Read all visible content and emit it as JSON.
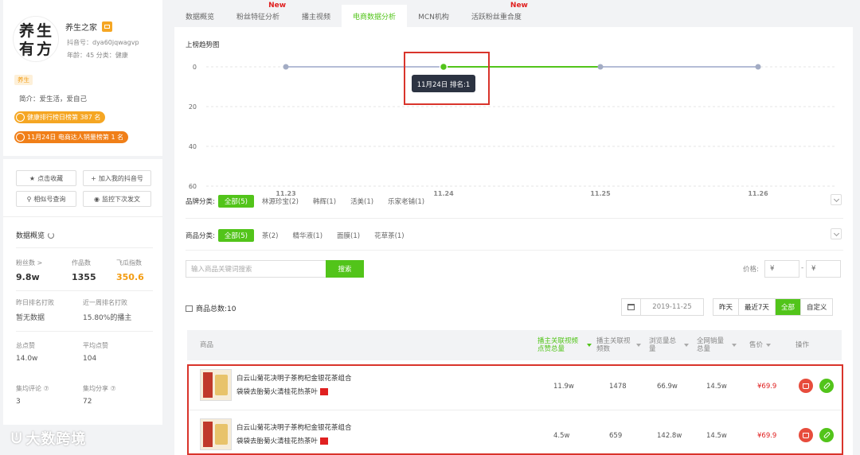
{
  "profile": {
    "avatar_text": "养生有方",
    "name": "养生之家",
    "douyin_id": "抖音号：dya60jqwagvp",
    "age_category": "年龄：45    分类：健康",
    "tag": "养生",
    "intro": "简介：爱生活，爱自己",
    "rank1": "健康排行榜日榜第 387 名",
    "rank2": "11月24日 电商达人销量榜第 1 名"
  },
  "actions": {
    "favorite": "点击收藏",
    "add_my": "加入我的抖音号",
    "similar": "相似号查询",
    "monitor": "监控下次发文"
  },
  "stats": {
    "title": "数据概览",
    "fans_label": "粉丝数 >",
    "fans_value": "9.8w",
    "works_label": "作品数",
    "works_value": "1355",
    "index_label": "飞瓜指数",
    "index_value": "350.6",
    "yesterday_rank_label": "昨日排名打败",
    "yesterday_rank_value": "暂无数据",
    "week_rank_label": "近一周排名打败",
    "week_rank_value": "15.80%的播主",
    "total_likes_label": "总点赞",
    "total_likes_value": "14.0w",
    "avg_likes_label": "平均点赞",
    "avg_likes_value": "104",
    "avg_comments_label": "集均评论 ⑦",
    "avg_comments_value": "3",
    "avg_shares_label": "集均分享 ⑦",
    "avg_shares_value": "72"
  },
  "watermark": "大数跨境",
  "tabs": [
    {
      "label": "数据概览",
      "new": ""
    },
    {
      "label": "粉丝特征分析",
      "new": "New"
    },
    {
      "label": "播主视频",
      "new": ""
    },
    {
      "label": "电商数据分析",
      "new": ""
    },
    {
      "label": "MCN机构",
      "new": ""
    },
    {
      "label": "活跃粉丝重合度",
      "new": "New"
    }
  ],
  "chart_data": {
    "type": "line",
    "title": "上榜趋势图",
    "categories": [
      "11.23",
      "11.24",
      "11.25",
      "11.26"
    ],
    "values": [
      null,
      1,
      null,
      null
    ],
    "y_ticks": [
      "0",
      "20",
      "40",
      "60"
    ],
    "ylim": [
      0,
      60
    ],
    "y_inverted": true,
    "tooltip": "11月24日 排名:1",
    "line_color": "#52c41a",
    "base_color": "#b4bcd6"
  },
  "filters": {
    "brand_label": "品牌分类:",
    "brand_options": [
      "全部(5)",
      "林源珍宝(2)",
      "韩辉(1)",
      "活美(1)",
      "乐家老铺(1)"
    ],
    "category_label": "商品分类:",
    "category_options": [
      "全部(5)",
      "茶(2)",
      "精华液(1)",
      "面膜(1)",
      "花草茶(1)"
    ]
  },
  "search": {
    "placeholder": "输入商品关键词搜索",
    "button": "搜索",
    "price_label": "价格:",
    "price_min": "¥",
    "price_max": "¥",
    "dash": "-"
  },
  "list": {
    "count": "商品总数:10",
    "date": "2019-11-25",
    "ranges": [
      "昨天",
      "最近7天",
      "全部",
      "自定义"
    ]
  },
  "table": {
    "headers": {
      "product": "商品",
      "views": "播主关联视频点赞总量",
      "videos": "播主关联视频数",
      "browse": "浏览量总量",
      "sales": "全网销量总量",
      "price": "售价",
      "ops": "操作"
    },
    "rows": [
      {
        "name1": "白云山菊花决明子茶枸杞金银花茶组合",
        "name2": "袋袋去胎菊火清桂花热茶叶",
        "views": "11.9w",
        "videos": "1478",
        "browse": "66.9w",
        "sales": "14.5w",
        "price": "¥69.9"
      },
      {
        "name1": "白云山菊花决明子茶枸杞金银花茶组合",
        "name2": "袋袋去胎菊火清桂花热茶叶",
        "views": "4.5w",
        "videos": "659",
        "browse": "142.8w",
        "sales": "14.5w",
        "price": "¥69.9"
      }
    ]
  },
  "colors": {
    "accent": "#52c41a",
    "orange": "#f39c12",
    "highlight": "#d9342b"
  }
}
